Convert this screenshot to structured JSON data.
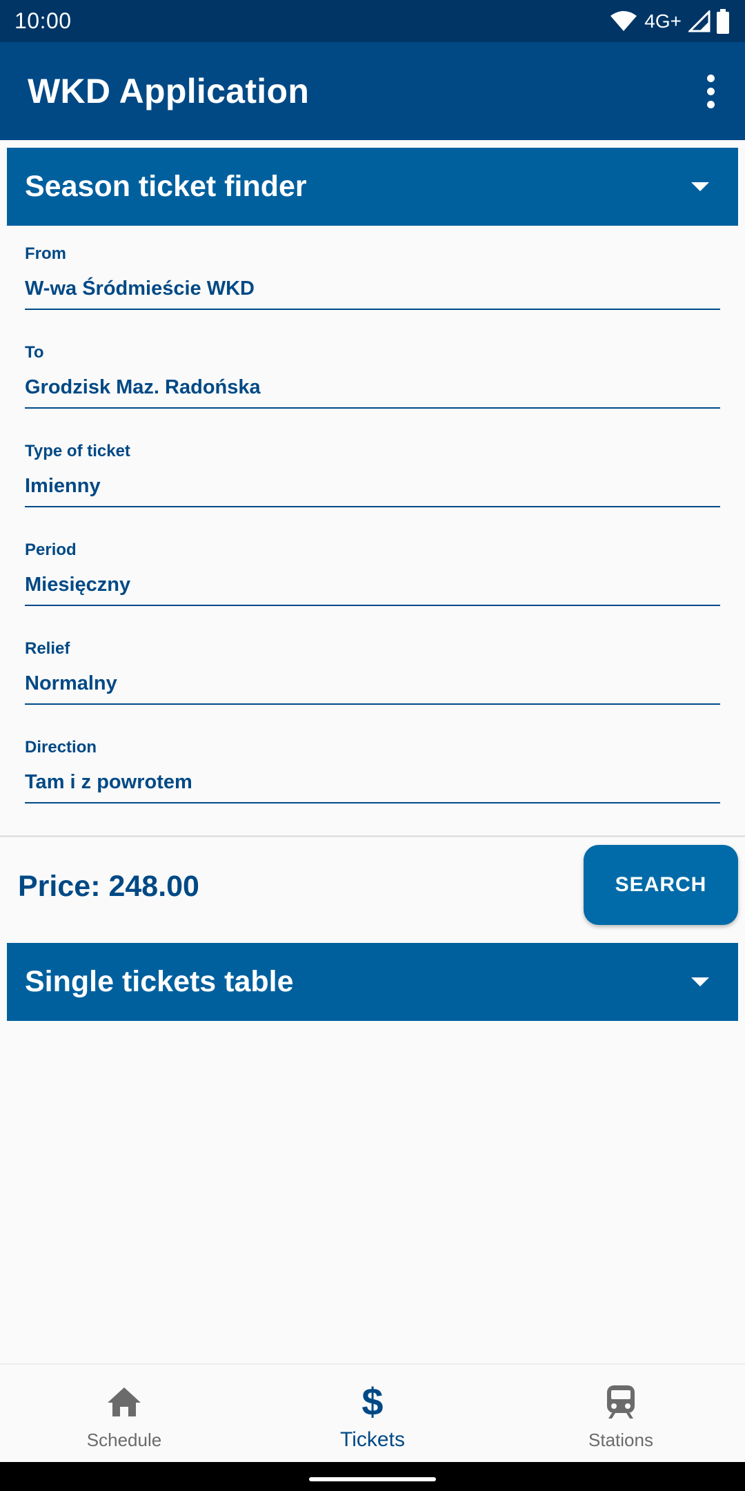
{
  "status_bar": {
    "time": "10:00",
    "network": "4G+",
    "icons": [
      "wifi-icon",
      "signal-icon",
      "battery-icon"
    ]
  },
  "app_bar": {
    "title": "WKD Application",
    "overflow_icon": "more-vert-icon"
  },
  "season_section": {
    "title": "Season ticket finder",
    "expand_icon": "caret-down-icon"
  },
  "form": {
    "fields": [
      {
        "label": "From",
        "value": "W-wa Śródmieście WKD"
      },
      {
        "label": "To",
        "value": "Grodzisk Maz. Radońska"
      },
      {
        "label": "Type of ticket",
        "value": "Imienny"
      },
      {
        "label": "Period",
        "value": "Miesięczny"
      },
      {
        "label": "Relief",
        "value": "Normalny"
      },
      {
        "label": "Direction",
        "value": "Tam i z powrotem"
      }
    ]
  },
  "price": {
    "text": "Price: 248.00"
  },
  "search_button": {
    "label": "SEARCH"
  },
  "single_section": {
    "title": "Single tickets table",
    "expand_icon": "caret-down-icon"
  },
  "bottom_nav": {
    "items": [
      {
        "label": "Schedule",
        "icon": "home-icon",
        "active": false
      },
      {
        "label": "Tickets",
        "icon": "dollar-icon",
        "active": true
      },
      {
        "label": "Stations",
        "icon": "train-icon",
        "active": false
      }
    ]
  },
  "colors": {
    "status_bar": "#003566",
    "app_bar": "#004985",
    "section_header": "#00609E",
    "button": "#006BA8",
    "text_primary": "#004985",
    "nav_inactive": "#6B6B6B"
  }
}
